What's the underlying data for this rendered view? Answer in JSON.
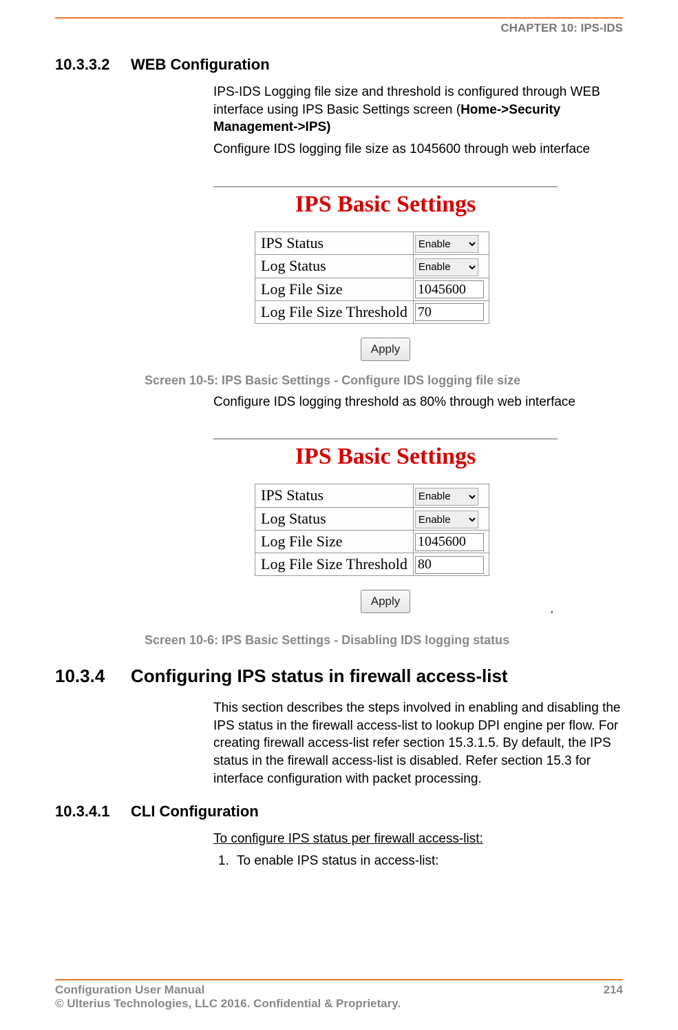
{
  "header": {
    "chapter": "CHAPTER 10: IPS-IDS"
  },
  "sections": {
    "s1": {
      "num": "10.3.3.2",
      "title": "WEB Configuration"
    },
    "s2": {
      "num": "10.3.4",
      "title": "Configuring IPS status in firewall access-list"
    },
    "s3": {
      "num": "10.3.4.1",
      "title": "CLI Configuration"
    }
  },
  "paragraphs": {
    "p1a": "IPS-IDS Logging file size and threshold is configured through WEB interface using IPS Basic Settings screen (",
    "p1b": "Home->Security Management->IPS)",
    "p2": "Configure IDS logging file size as 1045600 through web interface",
    "p3": "Configure IDS logging threshold as 80% through web interface",
    "p4": "This section describes the steps involved in enabling and disabling the IPS status in the firewall access-list to lookup DPI engine per flow. For creating firewall access-list refer section 15.3.1.5. By default, the IPS status in the firewall access-list is disabled. Refer section 15.3 for interface configuration with packet processing.",
    "p5": "To configure IPS status per firewall access-list:",
    "step1": "To enable IPS status in access-list:"
  },
  "captions": {
    "c1": "Screen 10-5: IPS Basic Settings - Configure IDS logging file size",
    "c2": "Screen 10-6: IPS Basic Settings - Disabling IDS logging status"
  },
  "figures": {
    "title": "IPS Basic Settings",
    "labels": {
      "ips_status": "IPS Status",
      "log_status": "Log Status",
      "log_file_size": "Log File Size",
      "log_file_thresh": "Log File Size Threshold"
    },
    "values": {
      "enable_option": "Enable",
      "fig1_size": "1045600",
      "fig1_thresh": "70",
      "fig2_size": "1045600",
      "fig2_thresh": "80"
    },
    "apply": "Apply"
  },
  "footer": {
    "left1": "Configuration User Manual",
    "left2": "© Ulterius Technologies, LLC 2016. Confidential & Proprietary.",
    "page": "214"
  },
  "chart_data": null
}
